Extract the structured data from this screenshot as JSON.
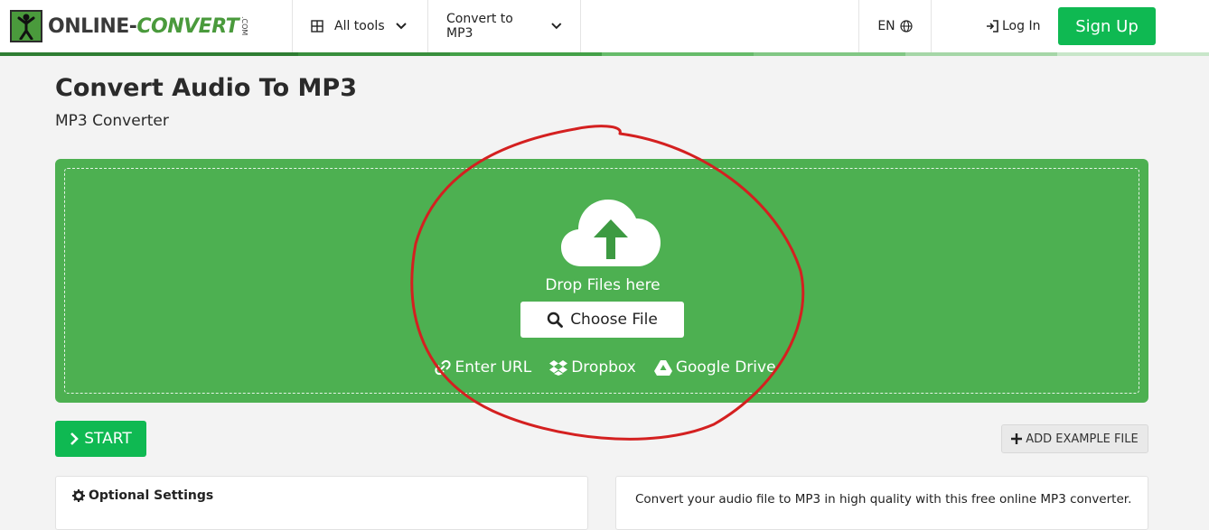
{
  "header": {
    "logo_main": "ONLINE-",
    "logo_accent": "CONVERT",
    "logo_suffix": ".COM",
    "all_tools_label": "All tools",
    "convert_label": "Convert to MP3",
    "language_label": "EN",
    "login_label": "Log In",
    "signup_label": "Sign Up"
  },
  "page": {
    "title": "Convert Audio To MP3",
    "subtitle": "MP3 Converter"
  },
  "dropzone": {
    "drop_text": "Drop Files here",
    "choose_label": "Choose File",
    "sources": [
      {
        "label": "Enter URL",
        "icon": "link-icon"
      },
      {
        "label": "Dropbox",
        "icon": "dropbox-icon"
      },
      {
        "label": "Google Drive",
        "icon": "google-drive-icon"
      }
    ]
  },
  "actions": {
    "start_label": "START",
    "example_label": "ADD EXAMPLE FILE"
  },
  "settings": {
    "title": "Optional Settings"
  },
  "description": {
    "text": "Convert your audio file to MP3 in high quality with this free online MP3 converter."
  },
  "colors": {
    "brand_green": "#0fb952",
    "dropzone_green": "#4db051",
    "annotation_red": "#d42020"
  }
}
